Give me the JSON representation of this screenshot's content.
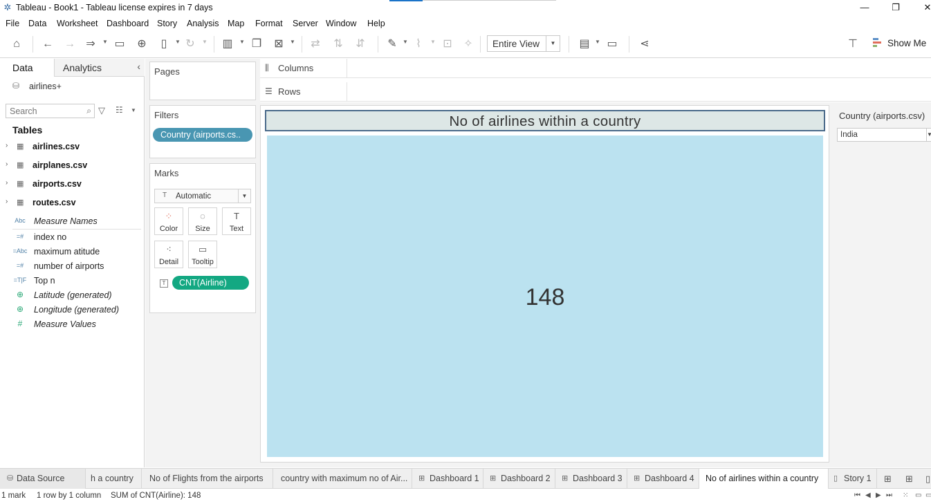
{
  "window": {
    "title": "Tableau - Book1 - Tableau license expires in 7 days",
    "controls": [
      "—",
      "❐",
      "✕"
    ]
  },
  "menu": [
    "File",
    "Data",
    "Worksheet",
    "Dashboard",
    "Story",
    "Analysis",
    "Map",
    "Format",
    "Server",
    "Window",
    "Help"
  ],
  "toolbar": {
    "fit_view": "Entire View",
    "show_me": "Show Me"
  },
  "data_pane": {
    "tabs": {
      "data": "Data",
      "analytics": "Analytics"
    },
    "datasource": "airlines+",
    "search_placeholder": "Search",
    "tables_header": "Tables",
    "tables": [
      "airlines.csv",
      "airplanes.csv",
      "airports.csv",
      "routes.csv"
    ],
    "fields": [
      {
        "type": "Abc",
        "name": "Measure Names",
        "italic": true
      },
      {
        "type": "=#",
        "name": "index no",
        "italic": false
      },
      {
        "type": "=Abc",
        "name": "maximum atitude",
        "italic": false
      },
      {
        "type": "=#",
        "name": "number of airports",
        "italic": false
      },
      {
        "type": "=T|F",
        "name": "Top n",
        "italic": false
      },
      {
        "type": "globe",
        "name": "Latitude (generated)",
        "italic": true
      },
      {
        "type": "globe",
        "name": "Longitude (generated)",
        "italic": true
      },
      {
        "type": "#",
        "name": "Measure Values",
        "italic": true
      }
    ]
  },
  "cards": {
    "pages": "Pages",
    "filters": "Filters",
    "filter_pill": "Country (airports.cs..",
    "marks": "Marks",
    "mark_type": "Automatic",
    "mark_buttons": [
      "Color",
      "Size",
      "Text",
      "Detail",
      "Tooltip"
    ],
    "text_pill": "CNT(Airline)"
  },
  "shelves": {
    "columns": "Columns",
    "rows": "Rows"
  },
  "view": {
    "title": "No of airlines within a country",
    "value": "148",
    "cell_color": "#bbe2f0"
  },
  "quick_filter": {
    "label": "Country (airports.csv)",
    "value": "India"
  },
  "sheet_tabs": {
    "data_source": "Data Source",
    "tabs": [
      {
        "label": "h a country",
        "kind": "sheet"
      },
      {
        "label": "No of Flights from the airports",
        "kind": "sheet"
      },
      {
        "label": "country with maximum no of Air...",
        "kind": "sheet"
      },
      {
        "label": "Dashboard 1",
        "kind": "dashboard"
      },
      {
        "label": "Dashboard 2",
        "kind": "dashboard"
      },
      {
        "label": "Dashboard 3",
        "kind": "dashboard"
      },
      {
        "label": "Dashboard 4",
        "kind": "dashboard"
      },
      {
        "label": "No of airlines within a country",
        "kind": "sheet-active"
      },
      {
        "label": "Story 1",
        "kind": "story"
      }
    ]
  },
  "status": {
    "marks": "1 mark",
    "dims": "1 row by 1 column",
    "sum": "SUM of CNT(Airline): 148"
  }
}
